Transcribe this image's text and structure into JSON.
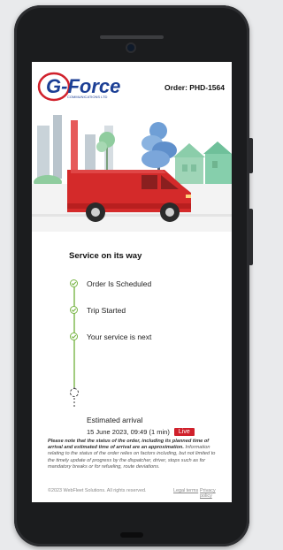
{
  "header": {
    "logo_text": "G-Force",
    "logo_subtext": "COMMUNICATIONS LTD",
    "order_label": "Order: PHD-1564"
  },
  "status": {
    "title": "Service on its way",
    "steps": [
      {
        "label": "Order Is Scheduled",
        "state": "done"
      },
      {
        "label": "Trip Started",
        "state": "done"
      },
      {
        "label": "Your service is next",
        "state": "done"
      },
      {
        "label": "Estimated arrival",
        "state": "pending"
      }
    ],
    "arrival_datetime": "15 June 2023, 09:49 (1 min)",
    "live_badge": "Live"
  },
  "disclaimer": {
    "bold": "Please note that the status of the order, including its planned time of arrival and estimated time of arrival are an approximation.",
    "text": "Information relating to the status of the order relies on factors including, but not limited to the timely update of progress by the dispatcher, driver, stops such as for mandatory breaks or for refueling, route deviations."
  },
  "footer": {
    "copyright": "©2023 WebFleet Solutions. All rights reserved.",
    "legal": "Legal terms",
    "privacy": "Privacy policy"
  },
  "colors": {
    "brand_red": "#d0202b",
    "brand_blue": "#1c3f95",
    "step_green": "#7ab648",
    "van_red": "#d42a2a",
    "house_green": "#9fd5b7",
    "tree_blue": "#6f9fd6"
  }
}
